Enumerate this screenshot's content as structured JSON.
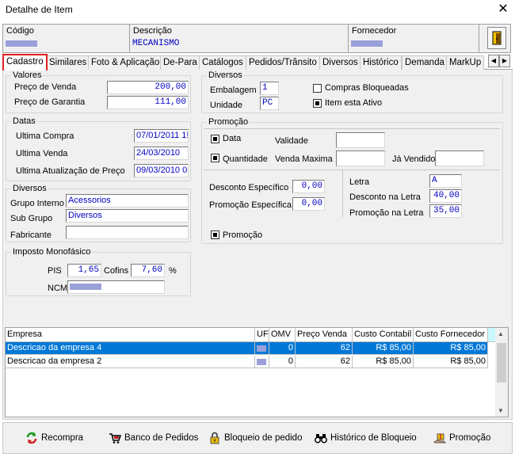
{
  "window": {
    "title": "Detalhe de Item",
    "close": "✕"
  },
  "header": {
    "codigo": {
      "label": "Código",
      "value": ""
    },
    "descricao": {
      "label": "Descrição",
      "value": "MECANISMO"
    },
    "fornecedor": {
      "label": "Fornecedor",
      "value": ""
    }
  },
  "tabs": [
    {
      "label": "Cadastro"
    },
    {
      "label": "Similares"
    },
    {
      "label": "Foto & Aplicação"
    },
    {
      "label": "De-Para"
    },
    {
      "label": "Catálogos"
    },
    {
      "label": "Pedidos/Trânsito"
    },
    {
      "label": "Diversos"
    },
    {
      "label": "Histórico"
    },
    {
      "label": "Demanda"
    },
    {
      "label": "MarkUp"
    }
  ],
  "valores": {
    "title": "Valores",
    "preco_venda_label": "Preço de Venda",
    "preco_venda": "200,00",
    "preco_garantia_label": "Preço de Garantia",
    "preco_garantia": "111,00"
  },
  "datas": {
    "title": "Datas",
    "ultima_compra_label": "Ultima Compra",
    "ultima_compra": "07/01/2011 1!",
    "ultima_venda_label": "Ultima Venda",
    "ultima_venda": "24/03/2010",
    "ultima_atualizacao_label": "Ultima Atualização de Preço",
    "ultima_atualizacao": "09/03/2010 0"
  },
  "diversos_left": {
    "title": "Diversos",
    "grupo_label": "Grupo Interno",
    "grupo": "Acessorios",
    "subgrupo_label": "Sub Grupo",
    "subgrupo": "Diversos",
    "fabricante_label": "Fabricante",
    "fabricante": ""
  },
  "imposto": {
    "title": "Imposto Monofásico",
    "pis_label": "PIS",
    "pis": "1,65",
    "cofins_label": "Cofins",
    "cofins": "7,60",
    "pct": "%",
    "ncm_label": "NCM",
    "ncm": ""
  },
  "diversos_right": {
    "title": "Diversos",
    "embalagem_label": "Embalagem",
    "embalagem": "1",
    "unidade_label": "Unidade",
    "unidade": "PC",
    "compras_bloq_label": "Compras Bloqueadas",
    "compras_bloq": false,
    "ativo_label": "Item esta Ativo",
    "ativo": true
  },
  "promocao": {
    "title": "Promoção",
    "data_label": "Data",
    "data_checked": true,
    "validade_label": "Validade",
    "validade": "",
    "quantidade_label": "Quantidade",
    "quantidade_checked": true,
    "venda_maxima_label": "Venda Maxima",
    "venda_maxima": "",
    "ja_vendido_label": "Já Vendido",
    "ja_vendido": "",
    "desc_especifico_label": "Desconto Específico",
    "desc_especifico": "0,00",
    "promo_especifica_label": "Promoção Específica",
    "promo_especifica": "0,00",
    "letra_label": "Letra",
    "letra": "A",
    "desc_letra_label": "Desconto na Letra",
    "desc_letra": "40,00",
    "promo_letra_label": "Promoção na Letra",
    "promo_letra": "35,00",
    "promocao_chk_label": "Promoção",
    "promocao_checked": true
  },
  "grid": {
    "columns": [
      "Empresa",
      "UF",
      "OMV",
      "Preço Venda",
      "Custo Contabil",
      "Custo Fornecedor"
    ],
    "rows": [
      {
        "empresa": "Descricao da empresa 4",
        "uf": "",
        "omv": "0",
        "preco": "62",
        "contabil": "R$ 85,00",
        "fornecedor": "R$ 85,00",
        "selected": true
      },
      {
        "empresa": "Descricao da empresa 2",
        "uf": "",
        "omv": "0",
        "preco": "62",
        "contabil": "R$ 85,00",
        "fornecedor": "R$ 85,00",
        "selected": false
      }
    ]
  },
  "buttons": {
    "recompra": "Recompra",
    "banco_pedidos": "Banco de Pedidos",
    "bloqueio_pedido": "Bloqueio de pedido",
    "historico_bloqueio": "Histórico de Bloqueio",
    "promocao": "Promoção"
  },
  "colors": {
    "accent": "#0000c0",
    "selection": "#0078d7",
    "active_tab_border": "#e02020"
  }
}
